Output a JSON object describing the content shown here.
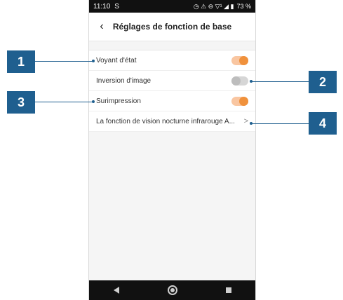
{
  "status_bar": {
    "time": "11:10",
    "left_icon": "S",
    "icons": "◷ ⚠ ⊖ ▽¹ ◢ ▮",
    "battery": "73 %"
  },
  "header": {
    "title": "Réglages de fonction de base",
    "back_icon": "back-arrow-icon"
  },
  "settings": [
    {
      "label": "Voyant d'état",
      "type": "toggle",
      "on": true
    },
    {
      "label": "Inversion d'image",
      "type": "toggle",
      "on": false
    },
    {
      "label": "Surimpression",
      "type": "toggle",
      "on": true
    },
    {
      "label": "La fonction de vision nocturne infrarouge A...",
      "type": "link"
    }
  ],
  "callouts": [
    "1",
    "2",
    "3",
    "4"
  ],
  "colors": {
    "accent": "#f0913c",
    "callout": "#1f5f8f"
  }
}
